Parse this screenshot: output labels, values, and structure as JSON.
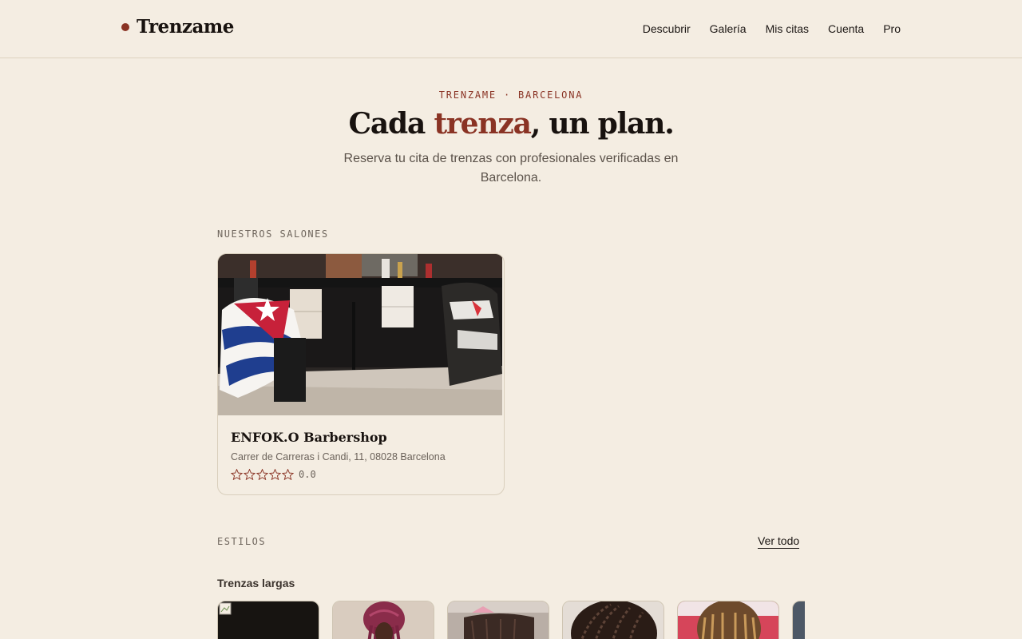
{
  "brand": {
    "name": "Trenzame",
    "accent": "#8a3324"
  },
  "nav": {
    "items": [
      "Descubrir",
      "Galería",
      "Mis citas",
      "Cuenta",
      "Pro"
    ]
  },
  "hero": {
    "eyebrow": "TRENZAME · BARCELONA",
    "headline_before": "Cada ",
    "headline_accent": "trenza",
    "headline_after": ", un plan.",
    "subtitle": "Reserva tu cita de trenzas con profesionales verificadas en Barcelona."
  },
  "salons": {
    "label": "NUESTROS SALONES",
    "items": [
      {
        "name": "ENFOK.O Barbershop",
        "address": "Carrer de Carreras i Candi, 11, 08028 Barcelona",
        "rating": "0.0",
        "stars_filled": 0,
        "stars_total": 5
      }
    ]
  },
  "styles": {
    "label": "ESTILOS",
    "view_all": "Ver todo",
    "group_title": "Trenzas largas"
  }
}
